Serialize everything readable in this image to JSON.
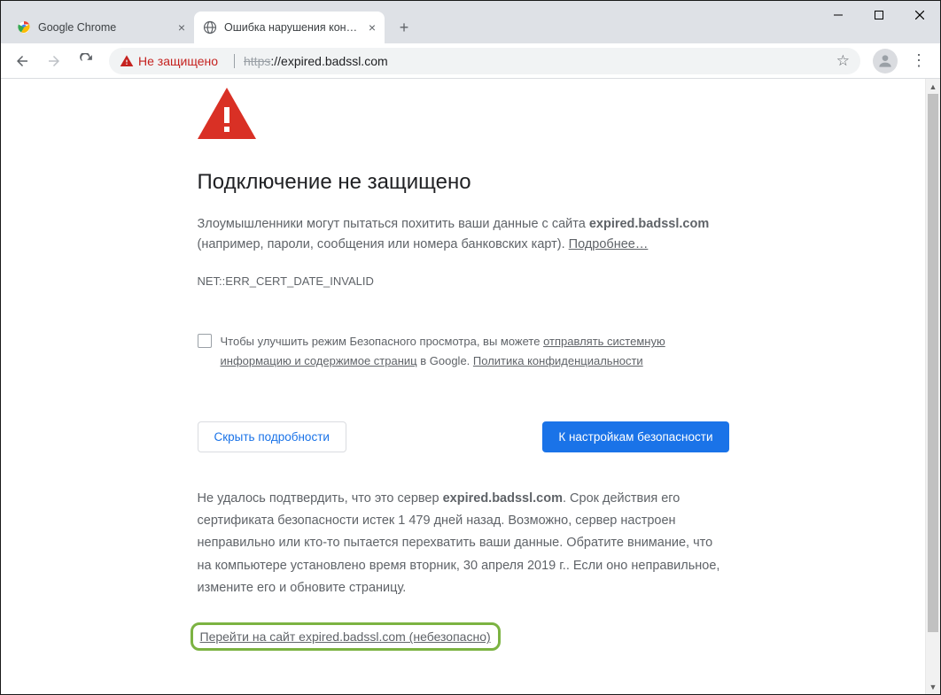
{
  "window": {
    "tabs": [
      {
        "title": "Google Chrome",
        "favicon": "chrome"
      },
      {
        "title": "Ошибка нарушения конфиденц",
        "favicon": "globe",
        "active": true
      }
    ]
  },
  "toolbar": {
    "security_label": "Не защищено",
    "url_scheme": "https",
    "url_sep": "://",
    "url_host": "expired.badssl.com"
  },
  "page": {
    "heading": "Подключение не защищено",
    "p1_a": "Злоумышленники могут пытаться похитить ваши данные с сайта ",
    "p1_host": "expired.badssl.com",
    "p1_b": " (например, пароли, сообщения или номера банковских карт). ",
    "learn_more": "Подробнее…",
    "error_code": "NET::ERR_CERT_DATE_INVALID",
    "cb_a": "Чтобы улучшить режим Безопасного просмотра, вы можете ",
    "cb_link1": "отправлять системную информацию и содержимое страниц",
    "cb_b": " в Google. ",
    "cb_link2": "Политика конфиденциальности",
    "btn_hide": "Скрыть подробности",
    "btn_safety": "К настройкам безопасности",
    "details_a": "Не удалось подтвердить, что это сервер ",
    "details_host": "expired.badssl.com",
    "details_b": ". Срок действия его сертификата безопасности истек 1 479 дней назад. Возможно, сервер настроен неправильно или кто-то пытается перехватить ваши данные. Обратите внимание, что на компьютере установлено время вторник, 30 апреля 2019 г.. Если оно неправильное, измените его и обновите страницу.",
    "proceed": "Перейти на сайт expired.badssl.com (небезопасно)"
  }
}
